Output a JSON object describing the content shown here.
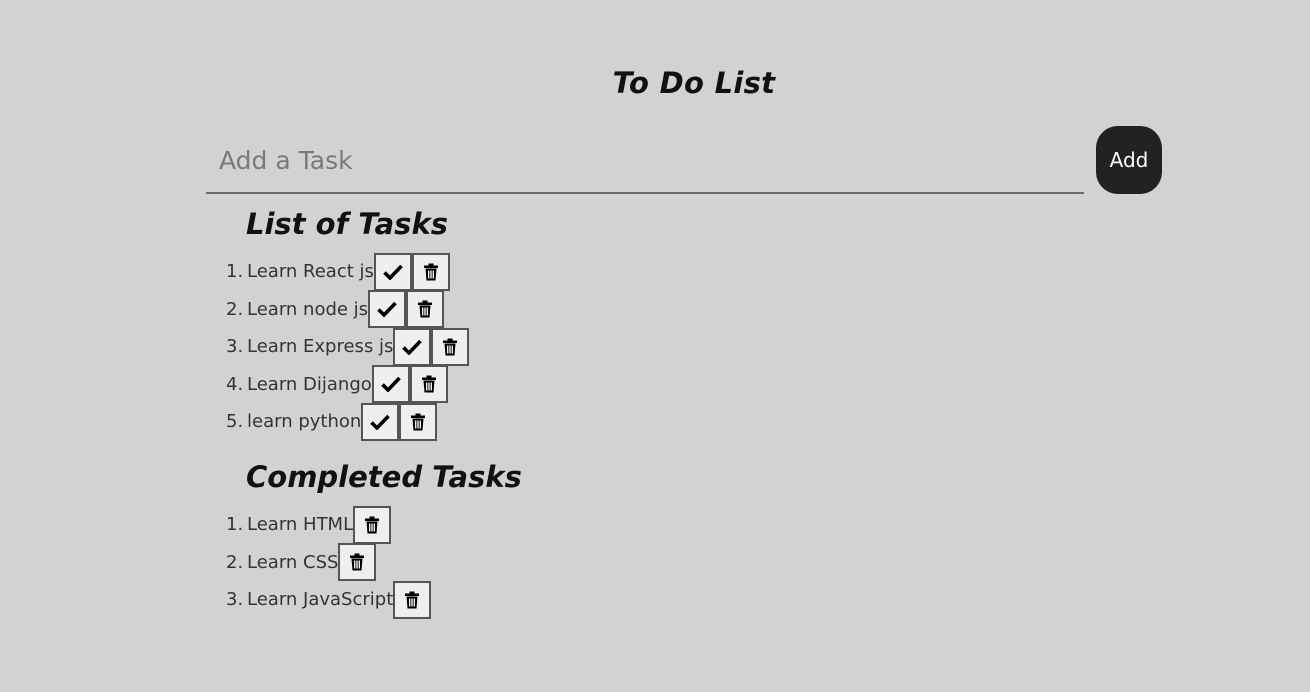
{
  "app": {
    "title": "To Do List"
  },
  "input": {
    "placeholder": "Add a Task",
    "value": ""
  },
  "add_button": {
    "label": "Add"
  },
  "pending": {
    "title": "List of Tasks",
    "items": [
      {
        "num": "1.",
        "text": "Learn React js"
      },
      {
        "num": "2.",
        "text": "Learn node js"
      },
      {
        "num": "3.",
        "text": "Learn Express js"
      },
      {
        "num": "4.",
        "text": "Learn Dijango"
      },
      {
        "num": "5.",
        "text": "learn python"
      }
    ]
  },
  "completed": {
    "title": "Completed Tasks",
    "items": [
      {
        "num": "1.",
        "text": "Learn HTML"
      },
      {
        "num": "2.",
        "text": "Learn CSS"
      },
      {
        "num": "3.",
        "text": "Learn JavaScript"
      }
    ]
  },
  "icons": {
    "complete": "check-icon",
    "delete": "trash-icon"
  },
  "colors": {
    "background": "#d3d2d1",
    "add_button": "#222222",
    "icon_button": "#efefef"
  }
}
